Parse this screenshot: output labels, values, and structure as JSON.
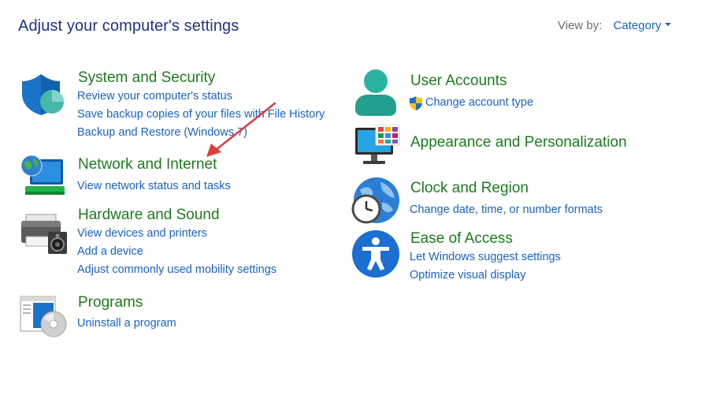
{
  "header": {
    "title": "Adjust your computer's settings",
    "view_by_label": "View by:",
    "view_by_value": "Category"
  },
  "categories": {
    "system_security": {
      "title": "System and Security",
      "links": [
        "Review your computer's status",
        "Save backup copies of your files with File History",
        "Backup and Restore (Windows 7)"
      ],
      "icon": "shield-icon"
    },
    "network_internet": {
      "title": "Network and Internet",
      "links": [
        "View network status and tasks"
      ],
      "icon": "network-globe-icon"
    },
    "hardware_sound": {
      "title": "Hardware and Sound",
      "links": [
        "View devices and printers",
        "Add a device",
        "Adjust commonly used mobility settings"
      ],
      "icon": "printer-speaker-icon"
    },
    "programs": {
      "title": "Programs",
      "links": [
        "Uninstall a program"
      ],
      "icon": "programs-disc-icon"
    },
    "user_accounts": {
      "title": "User Accounts",
      "links": [
        "Change account type"
      ],
      "icon": "user-icon",
      "link_icon": "uac-shield-icon"
    },
    "appearance": {
      "title": "Appearance and Personalization",
      "links": [],
      "icon": "monitor-palette-icon"
    },
    "clock_region": {
      "title": "Clock and Region",
      "links": [
        "Change date, time, or number formats"
      ],
      "icon": "clock-globe-icon"
    },
    "ease_access": {
      "title": "Ease of Access",
      "links": [
        "Let Windows suggest settings",
        "Optimize visual display"
      ],
      "icon": "accessibility-icon"
    }
  },
  "annotation": {
    "icon": "red-arrow-annotation",
    "color": "#e03c3c"
  },
  "colors": {
    "title_green": "#1e7b1e",
    "link_blue": "#1b62c4",
    "header_blue": "#1e3287"
  }
}
